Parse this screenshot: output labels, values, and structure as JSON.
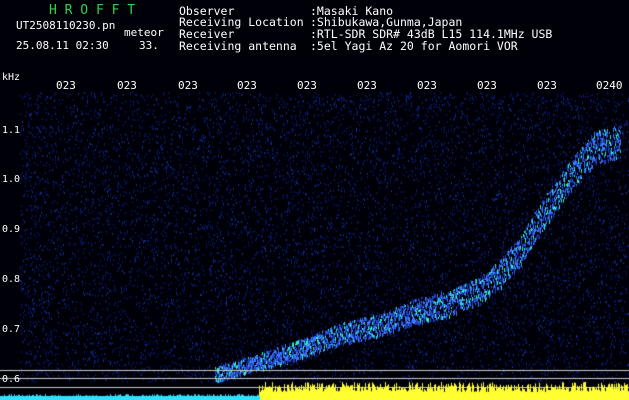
{
  "header": {
    "logo": "H R O F F T",
    "filename": "UT2508110230.pn",
    "tag": "meteor",
    "datetime": "25.08.11 02:30",
    "count": "33."
  },
  "info": [
    {
      "label": "Observer",
      "value": ":Masaki Kano"
    },
    {
      "label": "Receiving Location",
      "value": ":Shibukawa,Gunma,Japan"
    },
    {
      "label": "Receiver",
      "value": ":RTL-SDR SDR# 43dB L15 114.1MHz USB"
    },
    {
      "label": "Receiving antenna",
      "value": ":5el Yagi Az 20 for Aomori VOR"
    }
  ],
  "spectrogram": {
    "unit": "kHz",
    "y_ticks": [
      "1.1",
      "1.0",
      "0.9",
      "0.8",
      "0.7",
      "0.6"
    ],
    "x_ticks": [
      "023",
      "023",
      "023",
      "023",
      "023",
      "023",
      "023",
      "023",
      "023",
      "0240"
    ],
    "colors": {
      "background": "#000008",
      "noise": "#0a1a6a",
      "signal": "#3a7bff",
      "signal_hot": "#2ff0c0",
      "baseline_yellow": "#ffff30",
      "baseline_cyan": "#30e0ff",
      "ref_line": "#c8c8c8"
    }
  }
}
